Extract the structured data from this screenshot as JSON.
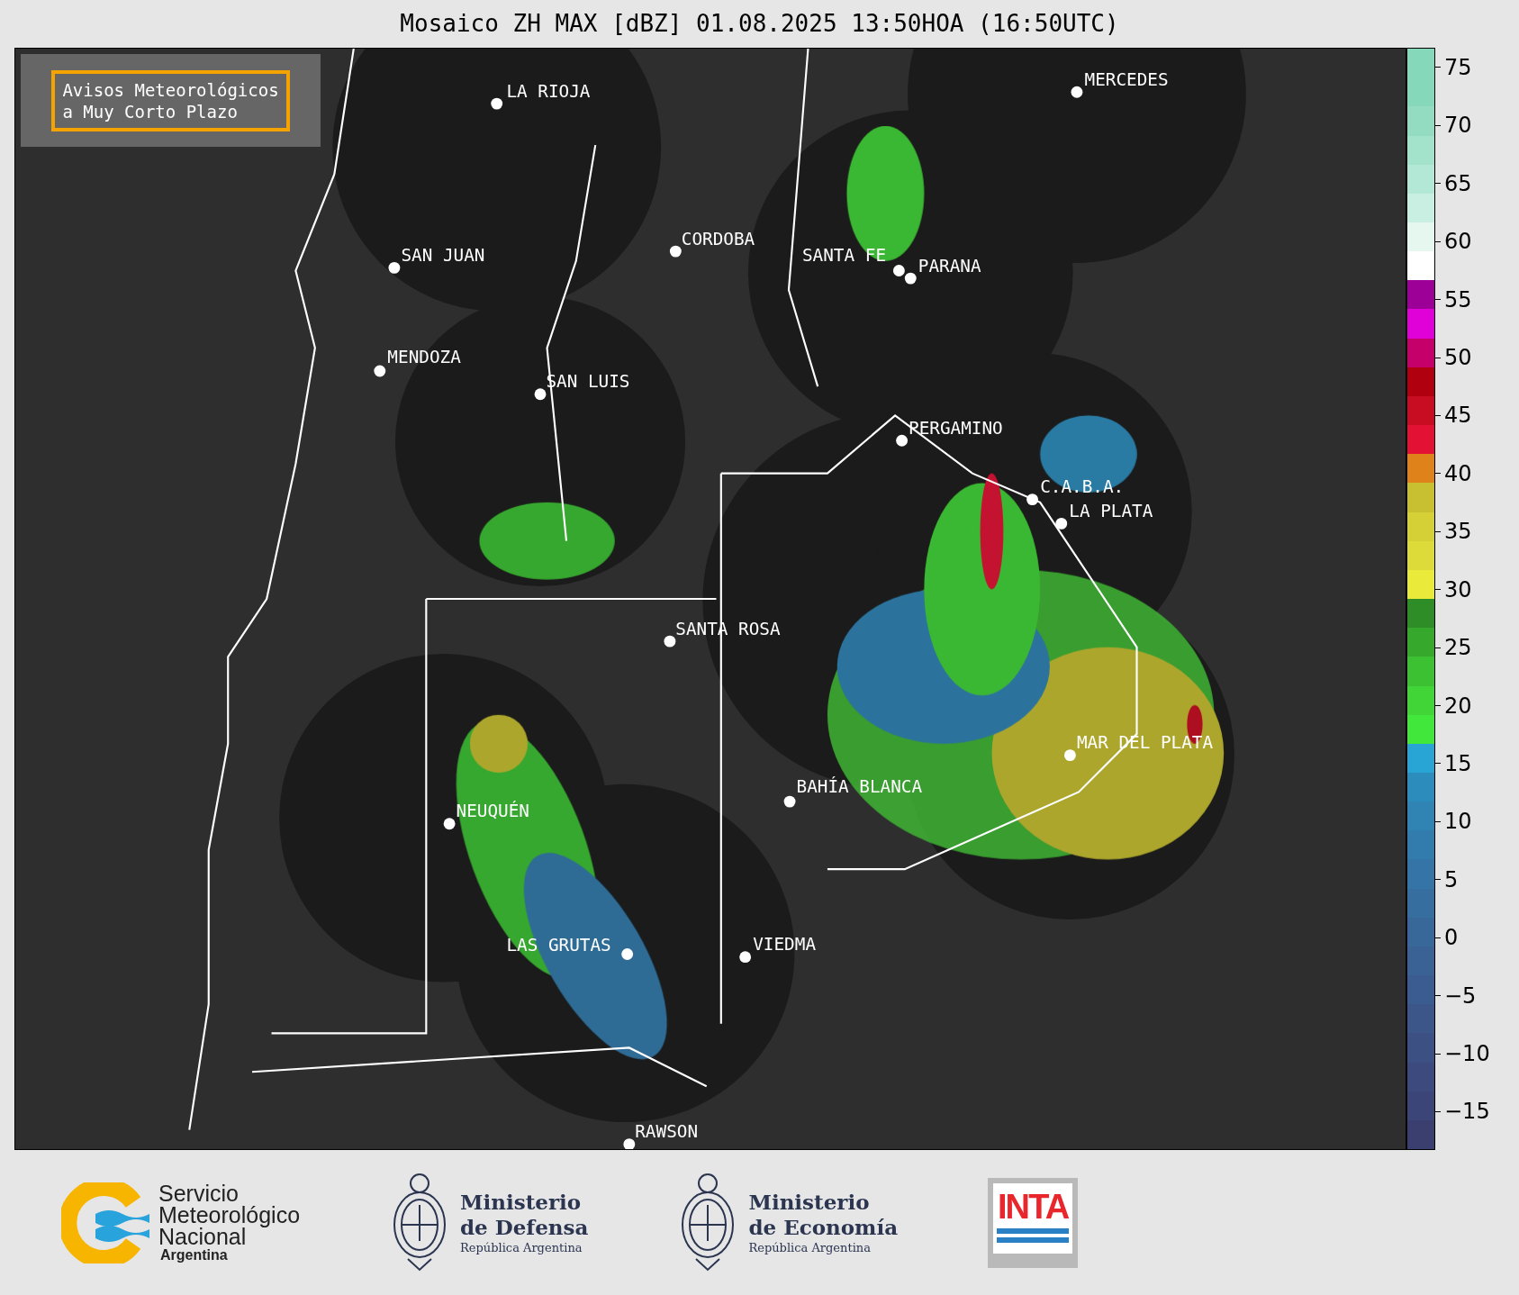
{
  "title": "Mosaico ZH MAX [dBZ] 01.08.2025 13:50HOA (16:50UTC)",
  "notice": [
    "Avisos Meteorológicos",
    "a Muy Corto Plazo"
  ],
  "cities": [
    {
      "name": "LA RIOJA"
    },
    {
      "name": "MERCEDES"
    },
    {
      "name": "SAN JUAN"
    },
    {
      "name": "CORDOBA"
    },
    {
      "name": "SANTA FE"
    },
    {
      "name": "PARANA"
    },
    {
      "name": "MENDOZA"
    },
    {
      "name": "SAN LUIS"
    },
    {
      "name": "PERGAMINO"
    },
    {
      "name": "C.A.B.A."
    },
    {
      "name": "LA PLATA"
    },
    {
      "name": "SANTA ROSA"
    },
    {
      "name": "MAR DEL PLATA"
    },
    {
      "name": "BAHÍA BLANCA"
    },
    {
      "name": "NEUQUÉN"
    },
    {
      "name": "LAS GRUTAS"
    },
    {
      "name": "VIEDMA"
    },
    {
      "name": "RAWSON"
    }
  ],
  "colorbar": {
    "ticks": [
      "75",
      "70",
      "65",
      "60",
      "55",
      "50",
      "45",
      "40",
      "35",
      "30",
      "25",
      "20",
      "15",
      "10",
      "5",
      "0",
      "−5",
      "−10",
      "−15"
    ],
    "segments": [
      {
        "color": "#3a3f6f"
      },
      {
        "color": "#3b4577"
      },
      {
        "color": "#3c4a7d"
      },
      {
        "color": "#3c5084"
      },
      {
        "color": "#3c568a"
      },
      {
        "color": "#3b5c90"
      },
      {
        "color": "#3a6295"
      },
      {
        "color": "#38689a"
      },
      {
        "color": "#366ea0"
      },
      {
        "color": "#3474a6"
      },
      {
        "color": "#327bad"
      },
      {
        "color": "#2f84b4"
      },
      {
        "color": "#2c8dbc"
      },
      {
        "color": "#28a5d4"
      },
      {
        "color": "#41e83b"
      },
      {
        "color": "#42d538"
      },
      {
        "color": "#3cc133"
      },
      {
        "color": "#36a92d"
      },
      {
        "color": "#2e8d26"
      },
      {
        "color": "#eaea3a"
      },
      {
        "color": "#dcdb3a"
      },
      {
        "color": "#d4d036"
      },
      {
        "color": "#c8c030"
      },
      {
        "color": "#e0821a"
      },
      {
        "color": "#e31235"
      },
      {
        "color": "#c80c22"
      },
      {
        "color": "#b00010"
      },
      {
        "color": "#c6006a"
      },
      {
        "color": "#e000d8"
      },
      {
        "color": "#9c0096"
      },
      {
        "color": "#ffffff"
      },
      {
        "color": "#e6f7f0"
      },
      {
        "color": "#c9efe2"
      },
      {
        "color": "#b3e8d6"
      },
      {
        "color": "#a3e3cc"
      },
      {
        "color": "#93dcc2"
      },
      {
        "color": "#86d8bb"
      },
      {
        "color": "#86d8bb"
      }
    ]
  },
  "logos": [
    {
      "kind": "smn",
      "lines": [
        "Servicio",
        "Meteorológico",
        "Nacional",
        "Argentina"
      ]
    },
    {
      "kind": "ministry",
      "lines": [
        "Ministerio",
        "de Defensa",
        "República Argentina"
      ]
    },
    {
      "kind": "ministry",
      "lines": [
        "Ministerio",
        "de Economía",
        "República Argentina"
      ]
    },
    {
      "kind": "inta",
      "lines": [
        "INTA"
      ]
    }
  ]
}
